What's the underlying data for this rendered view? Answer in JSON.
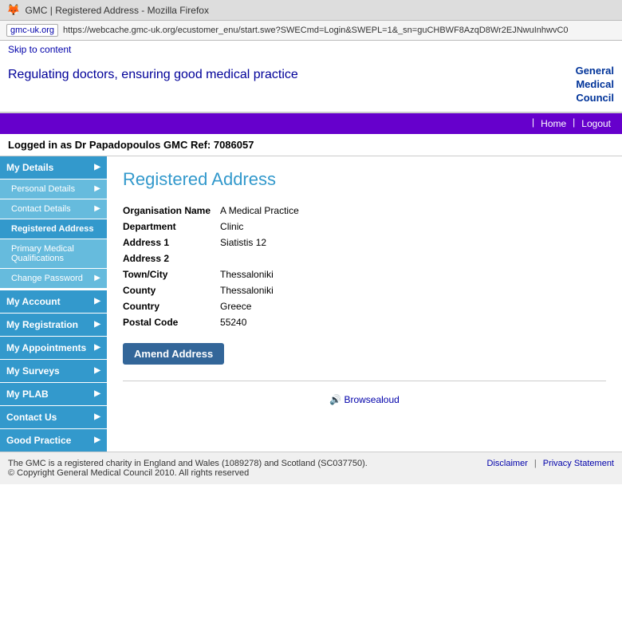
{
  "browser": {
    "icon": "🦊",
    "title": "GMC | Registered Address - Mozilla Firefox",
    "domain": "gmc-uk.org",
    "url": "https://webcache.gmc-uk.org/ecustomer_enu/start.swe?SWECmd=Login&SWEPL=1&_sn=guCHBWF8AzqD8Wr2EJNwuInhwvC0"
  },
  "header": {
    "skip_link": "Skip to content",
    "tagline": "Regulating doctors, ensuring good medical practice",
    "logo_line1": "General",
    "logo_line2": "Medical",
    "logo_line3": "Council"
  },
  "nav": {
    "home_label": "Home",
    "logout_label": "Logout"
  },
  "logged_in_bar": {
    "text": "Logged in as Dr Papadopoulos GMC Ref: 7086057"
  },
  "sidebar": {
    "my_details_label": "My Details",
    "items": [
      {
        "label": "Personal Details",
        "has_arrow": true,
        "active": false
      },
      {
        "label": "Contact Details",
        "has_arrow": true,
        "active": false
      },
      {
        "label": "Registered Address",
        "has_arrow": false,
        "active": true
      },
      {
        "label": "Primary Medical Qualifications",
        "has_arrow": false,
        "active": false
      },
      {
        "label": "Change Password",
        "has_arrow": true,
        "active": false
      }
    ],
    "top_level": [
      {
        "label": "My Account",
        "has_arrow": true
      },
      {
        "label": "My Registration",
        "has_arrow": true
      },
      {
        "label": "My Appointments",
        "has_arrow": true
      },
      {
        "label": "My Surveys",
        "has_arrow": true
      },
      {
        "label": "My PLAB",
        "has_arrow": true
      },
      {
        "label": "Contact Us",
        "has_arrow": true
      },
      {
        "label": "Good Practice",
        "has_arrow": true
      }
    ]
  },
  "content": {
    "page_title": "Registered Address",
    "address_fields": [
      {
        "label": "Organisation Name",
        "value": "A Medical Practice"
      },
      {
        "label": "Department",
        "value": "Clinic"
      },
      {
        "label": "Address 1",
        "value": "Siatistis 12"
      },
      {
        "label": "Address 2",
        "value": ""
      },
      {
        "label": "Town/City",
        "value": "Thessaloniki"
      },
      {
        "label": "County",
        "value": "Thessaloniki"
      },
      {
        "label": "Country",
        "value": "Greece"
      },
      {
        "label": "Postal Code",
        "value": "55240"
      }
    ],
    "amend_button": "Amend Address"
  },
  "browsealoud": {
    "icon": "🔊",
    "text": "Browsealoud"
  },
  "footer": {
    "left_line1": "The GMC is a registered charity in England and Wales (1089278) and Scotland (SC037750).",
    "left_line2": "© Copyright General Medical Council 2010. All rights reserved",
    "disclaimer": "Disclaimer",
    "privacy": "Privacy Statement"
  }
}
